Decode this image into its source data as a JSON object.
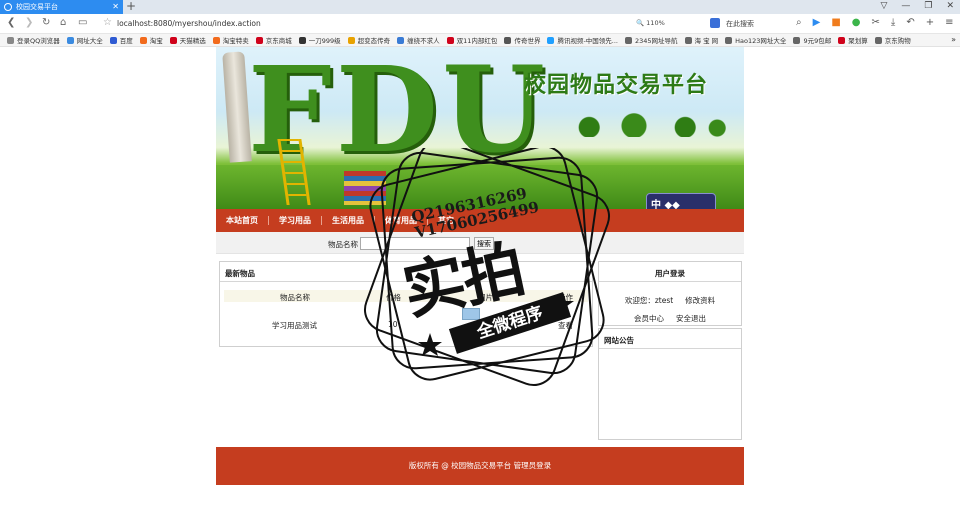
{
  "browser": {
    "tab_title": "校园交易平台",
    "new_tab": "+",
    "url": "localhost:8080/myershou/index.action",
    "zoom": "110%",
    "search_placeholder": "在此搜索",
    "window_buttons": [
      "▽",
      "—",
      "❐",
      "✕"
    ],
    "toolbar_icons": [
      "search-icon",
      "play-icon",
      "video-icon",
      "wechat-icon",
      "scissors-icon",
      "download-icon",
      "undo-icon",
      "plus-icon",
      "menu-icon"
    ],
    "bookmarks": [
      {
        "label": "登录QQ浏览器",
        "color": "#888888"
      },
      {
        "label": "网址大全",
        "color": "#3b8be0"
      },
      {
        "label": "百度",
        "color": "#2f5bd3"
      },
      {
        "label": "淘宝",
        "color": "#f26b1d"
      },
      {
        "label": "天猫精选",
        "color": "#d0021b"
      },
      {
        "label": "淘宝特卖",
        "color": "#f26b1d"
      },
      {
        "label": "京东商城",
        "color": "#d0021b"
      },
      {
        "label": "一刀999级",
        "color": "#333333"
      },
      {
        "label": "超变态传奇",
        "color": "#e8a200"
      },
      {
        "label": "缠绕不求人",
        "color": "#3a7bd5"
      },
      {
        "label": "双11内部红包",
        "color": "#d0021b"
      },
      {
        "label": "传奇世界",
        "color": "#555555"
      },
      {
        "label": "腾讯视频-中国领先...",
        "color": "#20a0ff"
      },
      {
        "label": "2345网址导航",
        "color": "#666666"
      },
      {
        "label": "海 宝 网",
        "color": "#666666"
      },
      {
        "label": "Hao123网址大全",
        "color": "#666666"
      },
      {
        "label": "9元9包邮",
        "color": "#666666"
      },
      {
        "label": "聚划算",
        "color": "#d0021b"
      },
      {
        "label": "京东购物",
        "color": "#666666"
      }
    ],
    "bookmarks_more": "»"
  },
  "banner": {
    "letters": "FDU",
    "title": "校园物品交易平台",
    "badge": "中"
  },
  "menu": [
    "本站首页",
    "学习用品",
    "生活用品",
    "体育用品",
    "其它"
  ],
  "search": {
    "label": "物品名称",
    "value": "",
    "button": "搜索"
  },
  "latest": {
    "title": "最新物品",
    "columns": [
      "物品名称",
      "价格",
      "图片",
      "操作"
    ],
    "rows": [
      {
        "name": "学习用品测试",
        "price": "10",
        "op": "查看"
      }
    ]
  },
  "login": {
    "title": "用户登录",
    "welcome": "欢迎您：ztest",
    "edit_profile": "修改资料",
    "member_center": "会员中心",
    "logout": "安全退出"
  },
  "notice": {
    "title": "网站公告"
  },
  "footer": {
    "text": "版权所有 @ 校园物品交易平台",
    "admin_login": "管理员登录"
  },
  "watermark": {
    "contact1": "Q2196316269",
    "contact2": "V17060256499",
    "big": "实拍",
    "ribbon": "全微程序"
  }
}
